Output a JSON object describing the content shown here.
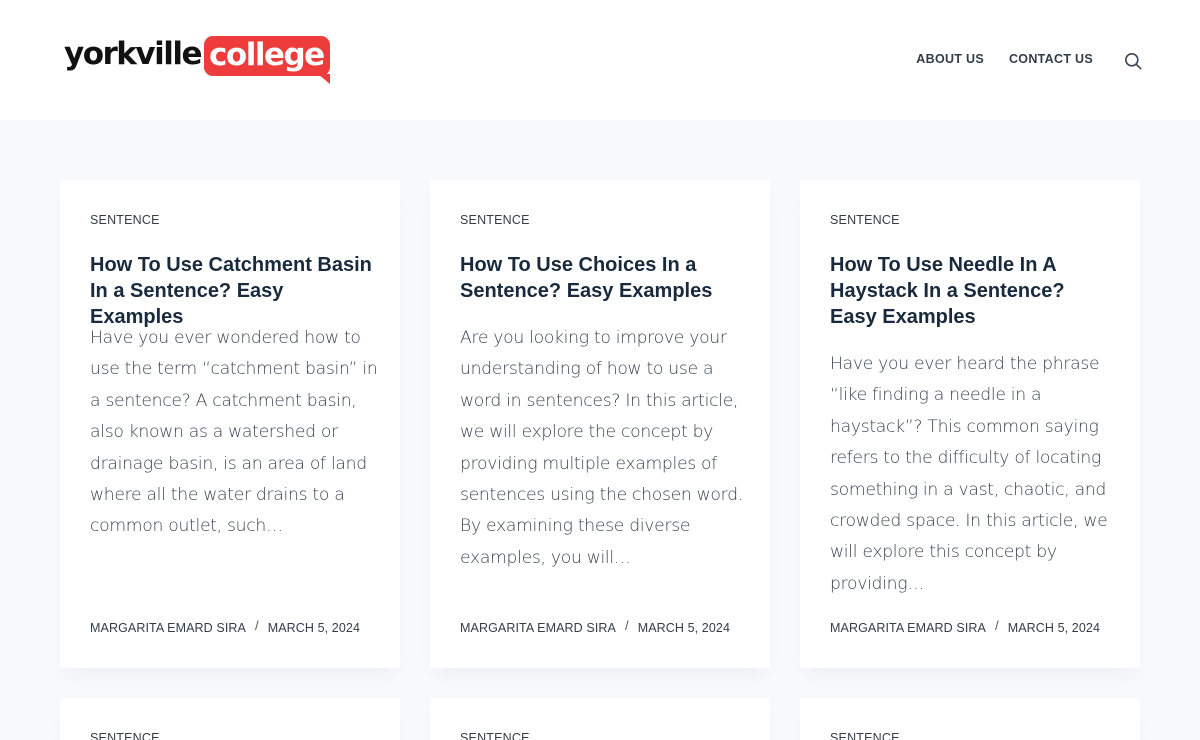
{
  "site": {
    "logo_dark": "yorkville",
    "logo_highlight": "college"
  },
  "nav": {
    "items": [
      "ABOUT US",
      "CONTACT US"
    ]
  },
  "search": {
    "icon": "search-icon"
  },
  "posts": [
    {
      "category": "SENTENCE",
      "title": "How To Use Catchment Basin In a Sentence? Easy Examples",
      "excerpt": "Have you ever wondered how to use the term “catchment basin” in a sentence? A catchment basin, also known as a watershed or drainage basin, is an area of land where all the water drains to a common outlet, such…",
      "author": "MARGARITA EMARD SIRA",
      "date": "MARCH 5, 2024"
    },
    {
      "category": "SENTENCE",
      "title": "How To Use Choices In a Sentence? Easy Examples",
      "excerpt": "Are you looking to improve your understanding of how to use a word in sentences? In this article, we will explore the concept by providing multiple examples of sentences using the chosen word. By examining these diverse examples, you will…",
      "author": "MARGARITA EMARD SIRA",
      "date": "MARCH 5, 2024"
    },
    {
      "category": "SENTENCE",
      "title": "How To Use Needle In A Haystack In a Sentence? Easy Examples",
      "excerpt": "Have you ever heard the phrase “like finding a needle in a haystack”? This common saying refers to the difficulty of locating something in a vast, chaotic, and crowded space. In this article, we will explore this concept by providing…",
      "author": "MARGARITA EMARD SIRA",
      "date": "MARCH 5, 2024"
    }
  ],
  "next_row": [
    {
      "category": "SENTENCE"
    },
    {
      "category": "SENTENCE"
    },
    {
      "category": "SENTENCE"
    }
  ],
  "meta_separator": "/",
  "colors": {
    "brand_red": "#ee3b3b",
    "heading": "#192a3d",
    "text": "#3a4553",
    "page_bg": "#f8f9fb"
  }
}
